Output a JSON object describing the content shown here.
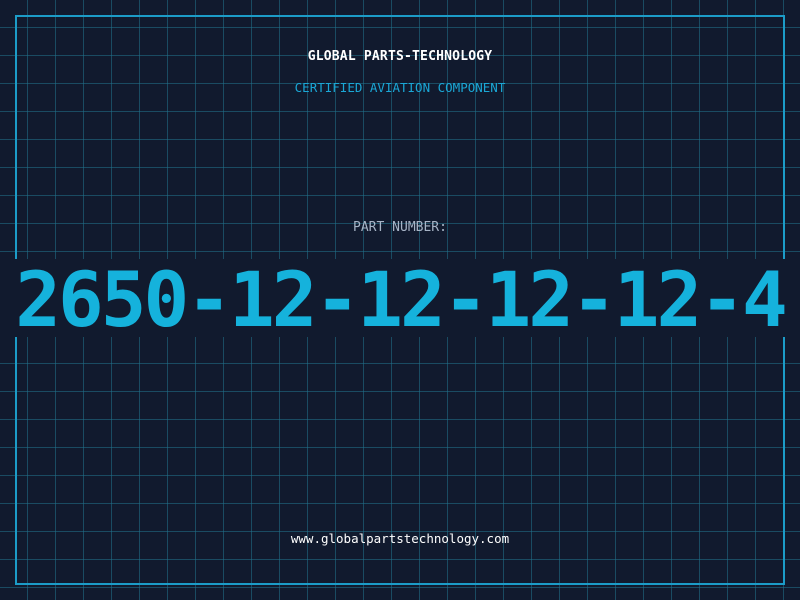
{
  "header": {
    "company": "GLOBAL PARTS-TECHNOLOGY",
    "tagline": "CERTIFIED AVIATION COMPONENT"
  },
  "part": {
    "label": "PART NUMBER:",
    "number": "2650-12-12-12-12-4"
  },
  "footer": {
    "website": "www.globalpartstechnology.com"
  },
  "colors": {
    "background": "#111a2e",
    "grid": "#20738c",
    "accent": "#1aa7d6",
    "frame": "#1c9cc8",
    "heading": "#ffffff",
    "label": "#a7b4c6"
  }
}
